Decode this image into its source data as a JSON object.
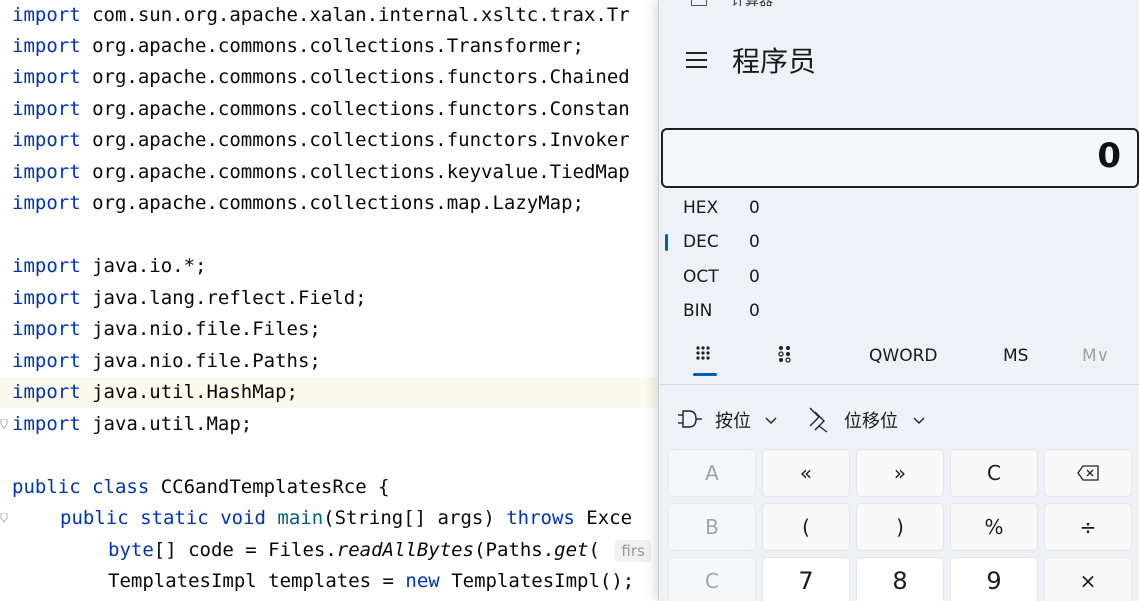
{
  "editor": {
    "lines": [
      {
        "kw": "import",
        "text": " com.sun.org.apache.xalan.internal.xsltc.trax.Tr"
      },
      {
        "kw": "import",
        "text": " org.apache.commons.collections.Transformer;"
      },
      {
        "kw": "import",
        "text": " org.apache.commons.collections.functors.Chained"
      },
      {
        "kw": "import",
        "text": " org.apache.commons.collections.functors.Constan"
      },
      {
        "kw": "import",
        "text": " org.apache.commons.collections.functors.Invoker"
      },
      {
        "kw": "import",
        "text": " org.apache.commons.collections.keyvalue.TiedMap"
      },
      {
        "kw": "import",
        "text": " org.apache.commons.collections.map.LazyMap;"
      },
      {
        "kw": "import",
        "text": " java.io.*;"
      },
      {
        "kw": "import",
        "text": " java.lang.reflect.Field;"
      },
      {
        "kw": "import",
        "text": " java.nio.file.Files;"
      },
      {
        "kw": "import",
        "text": " java.nio.file.Paths;"
      },
      {
        "kw": "import",
        "text": " java.util.HashMap;"
      },
      {
        "kw": "import",
        "text": " java.util.Map;"
      }
    ],
    "class_line": {
      "kw1": "public",
      "kw2": "class",
      "text": " CC6andTemplatesRce {"
    },
    "main_line": {
      "kw1": "public",
      "kw2": "static",
      "kw3": "void",
      "method": "main",
      "args": "(String[] args) ",
      "kw4": "throws",
      "tail": " Exce"
    },
    "byte_line": {
      "kw": "byte",
      "pre": "[] code = Files.",
      "call1": "readAllBytes",
      "mid": "(Paths.",
      "call2": "get",
      "open": "( ",
      "hint": "firs"
    },
    "templ_line": {
      "pre": "TemplatesImpl templates = ",
      "kw": "new",
      "post": " TemplatesImpl();"
    }
  },
  "calculator": {
    "window_title": "计算器",
    "mode_title": "程序员",
    "display_value": "0",
    "bases": [
      {
        "label": "HEX",
        "value": "0"
      },
      {
        "label": "DEC",
        "value": "0"
      },
      {
        "label": "OCT",
        "value": "0"
      },
      {
        "label": "BIN",
        "value": "0"
      }
    ],
    "tabs": {
      "word_size": "QWORD",
      "memory_store": "MS",
      "memory_menu": "M∨"
    },
    "bitwise_label": "按位",
    "bitshift_label": "位移位",
    "keys": {
      "a": "A",
      "lshift": "«",
      "rshift": "»",
      "clear": "C",
      "backspace": "⌫",
      "b": "B",
      "lparen": "(",
      "rparen": ")",
      "percent": "%",
      "divide": "÷",
      "c": "C",
      "seven": "7",
      "eight": "8",
      "nine": "9",
      "multiply": "×"
    },
    "accent_color": "#005fb8"
  }
}
